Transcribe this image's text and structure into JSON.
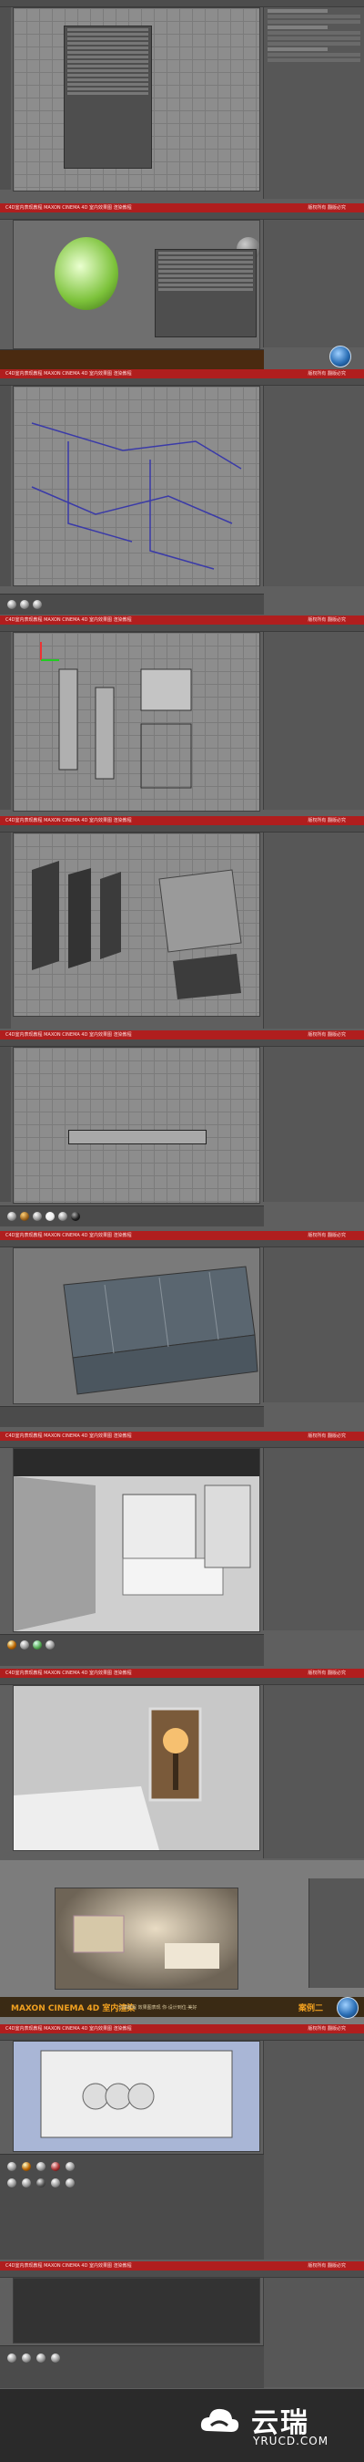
{
  "banner": {
    "left": "C4D室内表现教程 MAXON CINEMA 4D 室内效果图 渲染教程",
    "right": "版权所有 翻版必究"
  },
  "promo": {
    "title": "MAXON CINEMA 4D 室内渲染",
    "course_note": "云瑞教程 效果图表现 你·设计到位·美好",
    "case": "案例二"
  },
  "footer": {
    "brand": "云瑞",
    "domain": "YRUCD.COM"
  },
  "icons": {
    "c4d": "cinema4d-logo-icon",
    "cloud": "cloud-logo-icon"
  },
  "colors": {
    "banner": "#b01e1e",
    "promo_accent": "#f0a020",
    "viewport": "#8d8d8d",
    "ui_dark": "#4e4e4e"
  }
}
